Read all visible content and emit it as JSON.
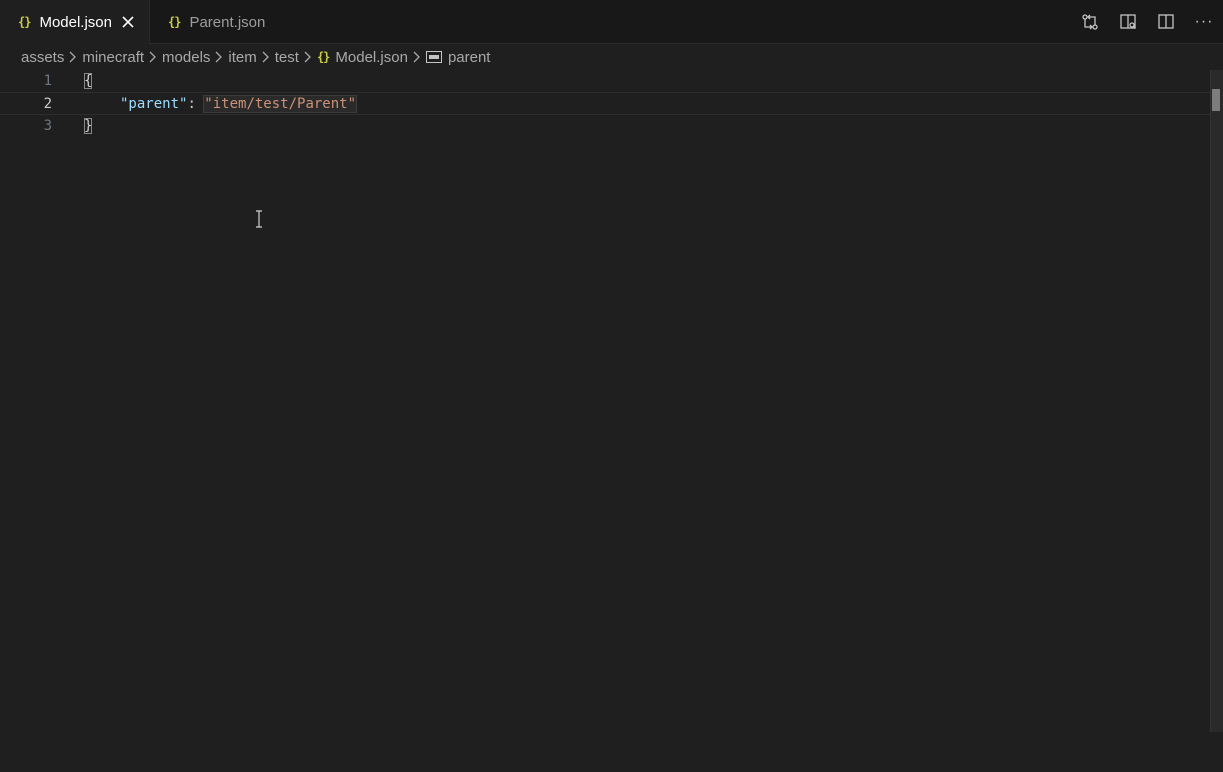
{
  "tabs": [
    {
      "label": "Model.json",
      "icon": "json-braces-icon",
      "active": true
    },
    {
      "label": "Parent.json",
      "icon": "json-braces-icon",
      "active": false
    }
  ],
  "tab_icon_glyph": "{}",
  "actions": [
    {
      "name": "open-changes-icon"
    },
    {
      "name": "open-preview-icon"
    },
    {
      "name": "split-editor-icon"
    },
    {
      "name": "more-actions-icon",
      "glyph": "···"
    }
  ],
  "breadcrumbs": {
    "items": [
      "assets",
      "minecraft",
      "models",
      "item",
      "test",
      "Model.json",
      "parent"
    ],
    "separator_icon": "chevron-right-icon"
  },
  "editor": {
    "line_numbers": [
      "1",
      "2",
      "3"
    ],
    "current_line": 2,
    "lines": {
      "open_brace": "{",
      "key": "\"parent\"",
      "colon": ": ",
      "value": "\"item/test/Parent\"",
      "close_brace": "}"
    }
  },
  "colors": {
    "background": "#1f1f1f",
    "tabbar": "#181818",
    "json_icon": "#cbcb41",
    "key": "#9cdcfe",
    "string": "#ce9178"
  }
}
